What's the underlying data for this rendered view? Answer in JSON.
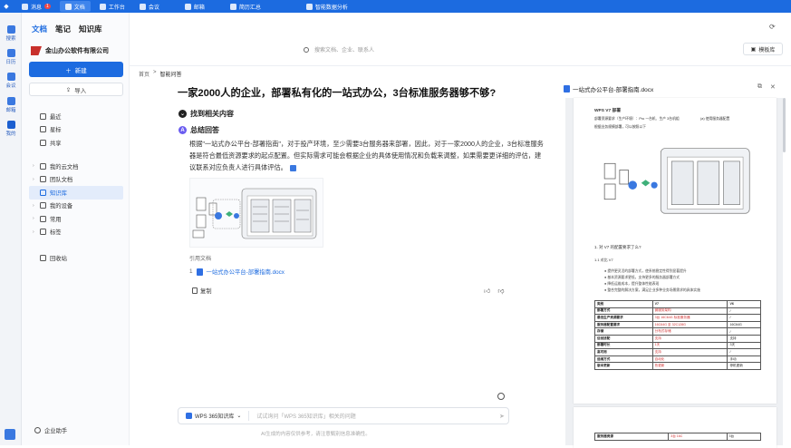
{
  "topbar": {
    "tabs": [
      {
        "label": "消息",
        "badge": "1"
      },
      {
        "label": "文档",
        "active": true
      },
      {
        "label": "工作台"
      },
      {
        "label": "会议"
      },
      {
        "label": "邮箱"
      },
      {
        "label": "简历汇总"
      },
      {
        "label": "智能数据分析"
      }
    ]
  },
  "rail": {
    "items": [
      "搜索",
      "日历",
      "会议",
      "邮箱",
      "我的"
    ]
  },
  "sidebar": {
    "tabs": [
      "文档",
      "笔记",
      "知识库"
    ],
    "company": "金山办公软件有限公司",
    "new_label": "新建",
    "import_label": "导入",
    "quick": [
      "最近",
      "星标",
      "共享"
    ],
    "tree": [
      {
        "label": "我的云文档",
        "arrow": "›"
      },
      {
        "label": "团队文档",
        "arrow": "›"
      },
      {
        "label": "知识库",
        "arrow": "",
        "selected": true
      },
      {
        "label": "我的设备",
        "arrow": "›"
      },
      {
        "label": "常用",
        "arrow": "›"
      },
      {
        "label": "标签",
        "arrow": "›"
      }
    ],
    "trash": "回收站",
    "enterprise": "企业助手"
  },
  "header": {
    "search_placeholder": "搜索文档、企业、联系人",
    "templates_label": "模板库"
  },
  "breadcrumb": {
    "home": "首页",
    "sep": ">",
    "current": "智能问答"
  },
  "question": "一家2000人的企业，部署私有化的一站式办公，3台标准服务器够不够?",
  "found_label": "找到相关内容",
  "summary_label": "总结回答",
  "answer_text": "根据\"一站式办公平台-部署指南\"，对于投产环境，至少需要3台服务器来部署，因此，对于一家2000人的企业，3台标准服务器是符合最低资源要求的起点配置。但实际需求可能会根据企业的具体使用情况和负载来调整，如果需要更详细的评估，建议联系对应负责人进行具体评估。",
  "references": {
    "header": "引用文档",
    "items": [
      {
        "num": "1",
        "label": "一站式办公平台-部署指南.docx"
      }
    ]
  },
  "copy_label": "复制",
  "input": {
    "kb_label": "WPS 365知识库",
    "placeholder": "试试询问「WPS 365知识库」相关的问题"
  },
  "disclaimer": "AI生成的内容仅供参考，请注意甄别信息准确性。",
  "preview": {
    "filename": "一站式办公平台-部署指南.docx",
    "doc_title": "WPS V7 部署",
    "doc_lines": [
      "部署资源要求（生产环境）：Pro 一台机、生产 3台机组",
      "(a) 使用服务器配置",
      "根据业务规模部署，可以按照以下"
    ],
    "section": "1. 对 V7 的配置要求了么?",
    "subsection": "1.1 对比  V7",
    "bullets": [
      "提供更灵活的部署方式，使系统稳定性得到显著提升",
      "基本资源要求更低，支持更多的服务器部署方式",
      "降低运维成本，提升整体性能表现",
      "整合完整的解决方案，满足企业多种业务场景需求的具体实施"
    ],
    "table": [
      [
        "类别",
        "V7",
        "V6"
      ],
      [
        "部署方式",
        "微服务架构",
        "/"
      ],
      [
        "最低生产资源要求",
        "3台 16C64G 标准服务器",
        "/"
      ],
      [
        "服务器配置要求",
        "16C64G 至 32C128G",
        "16C64G"
      ],
      [
        "存储",
        "分布式存储",
        "/"
      ],
      [
        "信创适配",
        "支持",
        "支持"
      ],
      [
        "部署时长",
        "1天",
        "3天"
      ],
      [
        "高可用",
        "支持",
        "/"
      ],
      [
        "运维方式",
        "自动化",
        "手动"
      ],
      [
        "版本更新",
        "热更新",
        "停机更新"
      ]
    ],
    "page2_row": [
      "服务器资源",
      "3台 16C",
      "3台"
    ]
  }
}
